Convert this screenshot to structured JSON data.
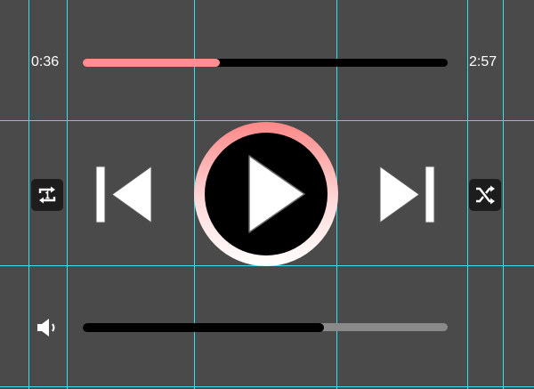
{
  "player": {
    "current_time": "0:36",
    "total_time": "2:57",
    "progress_fraction": 0.375,
    "volume_fraction": 0.66,
    "colors": {
      "accent": "#ff8e8e",
      "background": "#4a4a4a",
      "guide_lines": "#36e0f0",
      "track": "#000000",
      "volume_remaining": "#8a8a8a"
    },
    "controls": {
      "repeat_icon": "repeat-one-icon",
      "previous_icon": "skip-previous-icon",
      "play_icon": "play-icon",
      "next_icon": "skip-next-icon",
      "shuffle_icon": "shuffle-icon",
      "volume_icon": "speaker-icon"
    }
  }
}
